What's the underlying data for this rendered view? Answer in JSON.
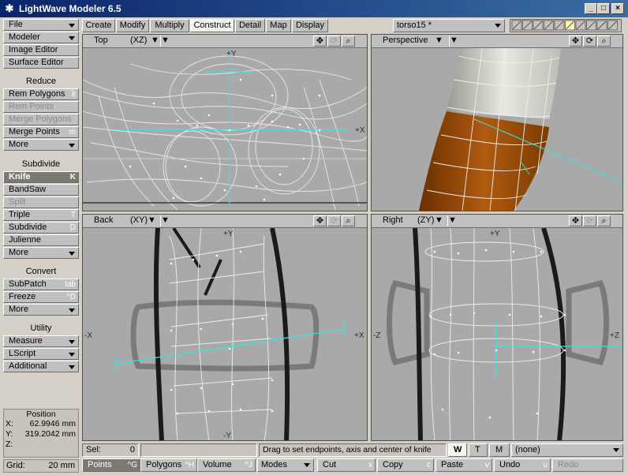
{
  "window": {
    "title": "LightWave Modeler 6.5",
    "min": "_",
    "max": "□",
    "close": "×"
  },
  "sidebar": {
    "file": "File",
    "modeler": "Modeler",
    "image_editor": "Image Editor",
    "surface_editor": "Surface Editor",
    "reduce_head": "Reduce",
    "rem_polygons": "Rem Polygons",
    "rem_polygons_key": "k",
    "rem_points": "Rem Points",
    "merge_polygons": "Merge Polygons",
    "merge_points": "Merge Points",
    "merge_points_key": "m",
    "more1": "More",
    "subdivide_head": "Subdivide",
    "knife": "Knife",
    "knife_key": "K",
    "bandsaw": "BandSaw",
    "split": "Split",
    "triple": "Triple",
    "triple_key": "T",
    "subdivide": "Subdivide",
    "subdivide_key": "D",
    "julienne": "Julienne",
    "more2": "More",
    "convert_head": "Convert",
    "subpatch": "SubPatch",
    "subpatch_key": "tab",
    "freeze": "Freeze",
    "freeze_key": "^D",
    "more3": "More",
    "utility_head": "Utility",
    "measure": "Measure",
    "lscript": "LScript",
    "additional": "Additional"
  },
  "position": {
    "title": "Position",
    "x_label": "X:",
    "x": "62.9946 mm",
    "y_label": "Y:",
    "y": "319.2042 mm",
    "z_label": "Z:"
  },
  "grid": {
    "label": "Grid:",
    "value": "20 mm"
  },
  "tabs": [
    "Create",
    "Modify",
    "Multiply",
    "Construct",
    "Detail",
    "Map",
    "Display"
  ],
  "object_combo": "torso15 *",
  "viewports": {
    "top": {
      "label": "Top",
      "axes": "(XZ)"
    },
    "perspective": {
      "label": "Perspective"
    },
    "back": {
      "label": "Back",
      "axes": "(XY)"
    },
    "right": {
      "label": "Right",
      "axes": "(ZY)"
    }
  },
  "axis_labels": {
    "y": "+Y",
    "ny": "-Y",
    "x": "+X",
    "nx": "-X",
    "z": "+Z",
    "nz": "-Z"
  },
  "status": {
    "sel_label": "Sel:",
    "sel_value": "0",
    "message": "Drag to set endpoints, axis and center of knife",
    "w": "W",
    "t": "T",
    "m": "M",
    "none": "(none)"
  },
  "bottom": {
    "points": "Points",
    "points_key": "^G",
    "polygons": "Polygons",
    "polygons_key": "^H",
    "volume": "Volume",
    "volume_key": "^J",
    "modes": "Modes",
    "cut": "Cut",
    "cut_key": "x",
    "copy": "Copy",
    "copy_key": "c",
    "paste": "Paste",
    "paste_key": "v",
    "undo": "Undo",
    "undo_key": "u",
    "redo": "Redo"
  },
  "colors": {
    "cyan": "#2ee6e6",
    "viewport_bg": "#a9a9a9",
    "wire": "#f0f0f0",
    "skin_dark": "#7a3c00",
    "skin_light": "#d8d8d0"
  }
}
